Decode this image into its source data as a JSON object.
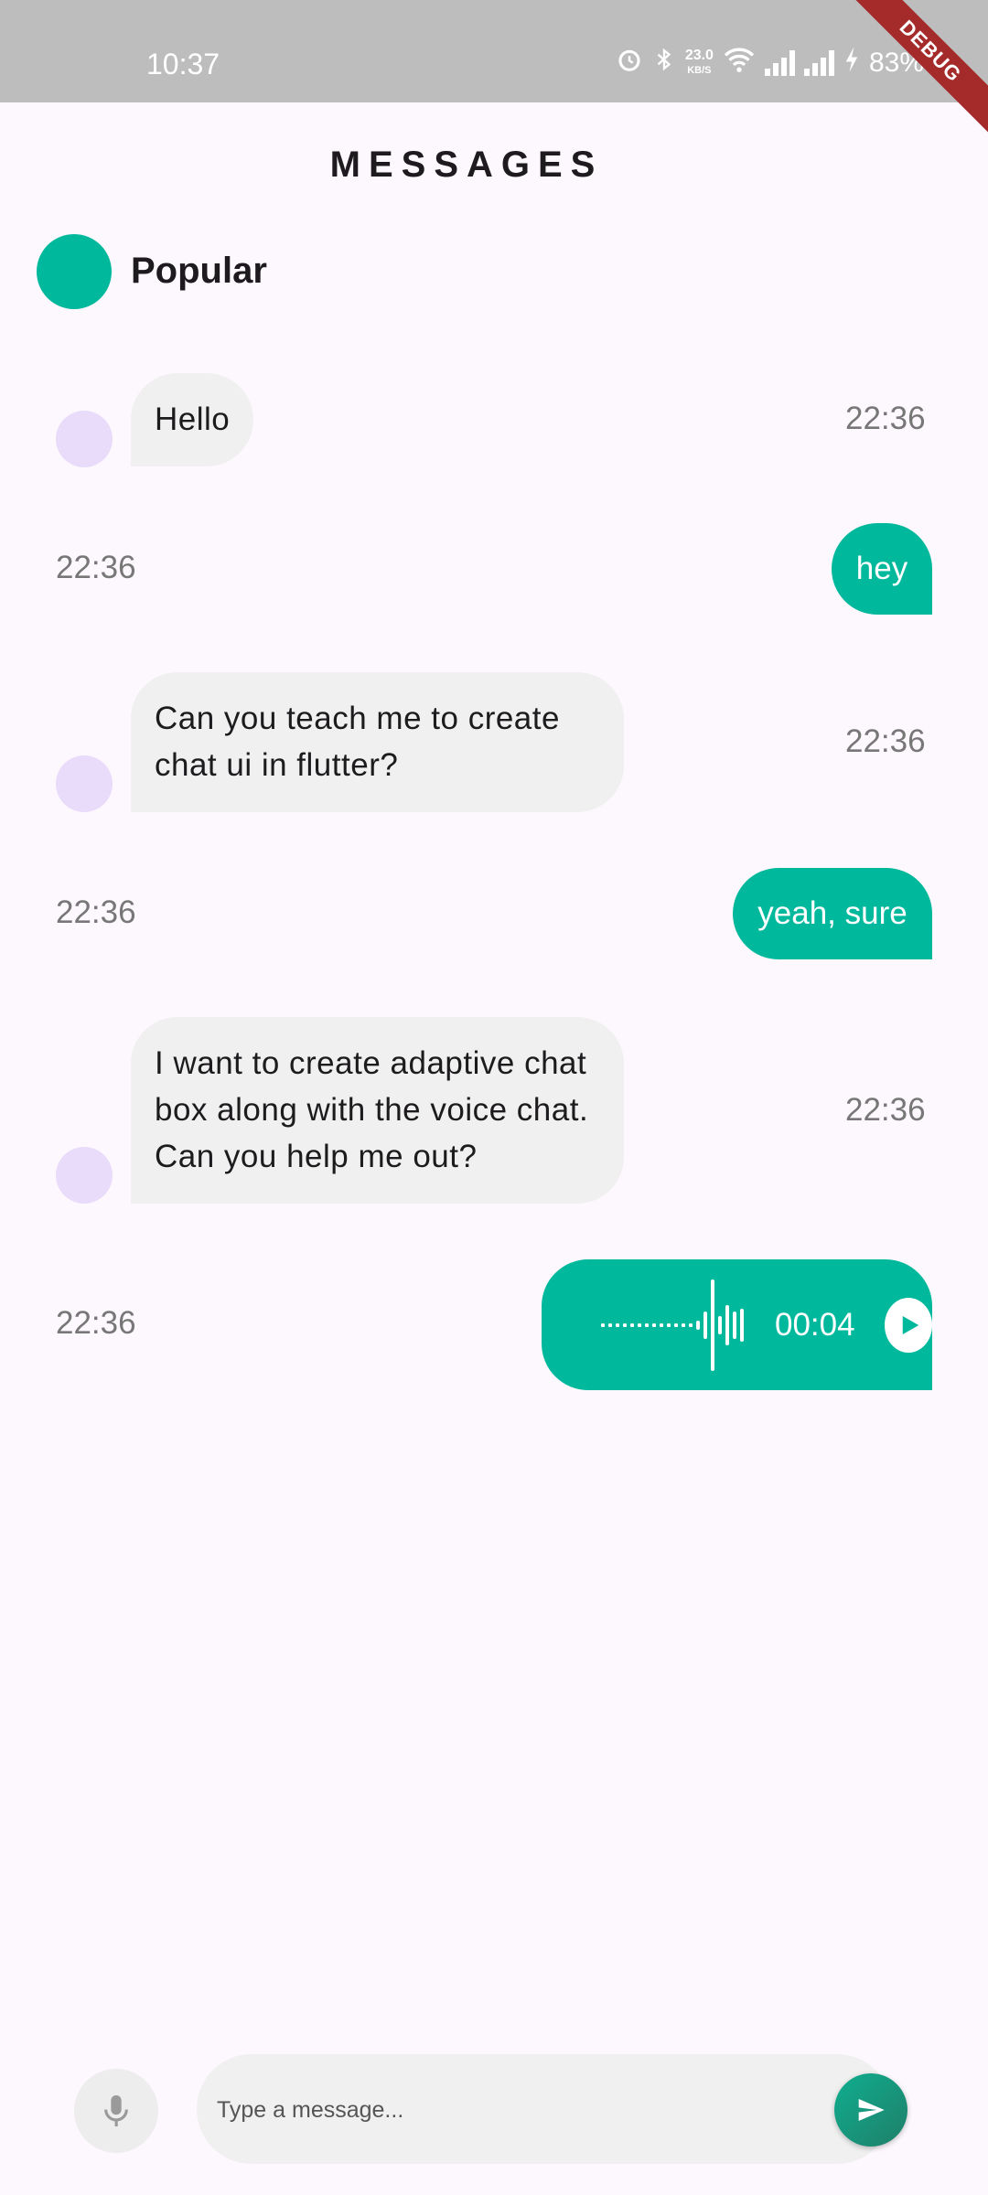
{
  "status_bar": {
    "time": "10:37",
    "net_speed_value": "23.0",
    "net_speed_unit": "KB/S",
    "battery": "83%",
    "debug_label": "DEBUG"
  },
  "header": {
    "title": "MESSAGES"
  },
  "group": {
    "name": "Popular",
    "avatar_color": "#00b89c"
  },
  "messages": [
    {
      "direction": "in",
      "text": "Hello",
      "time": "22:36"
    },
    {
      "direction": "out",
      "text": "hey",
      "time": "22:36"
    },
    {
      "direction": "in",
      "text": "Can you teach me to  create chat ui in flutter?",
      "time": "22:36"
    },
    {
      "direction": "out",
      "text": "yeah, sure",
      "time": "22:36"
    },
    {
      "direction": "in",
      "text": "I want to create adaptive chat box along with the voice chat. Can you help me out?",
      "time": "22:36"
    },
    {
      "direction": "out",
      "type": "voice",
      "duration": "00:04",
      "time": "22:36"
    }
  ],
  "composer": {
    "placeholder": "Type a message...",
    "mic_icon": "mic-icon",
    "send_icon": "send-icon"
  },
  "colors": {
    "accent": "#00b89c",
    "incoming_bubble": "#eff0ef",
    "avatar": "#e8dcfa",
    "background": "#fdf8fd"
  }
}
